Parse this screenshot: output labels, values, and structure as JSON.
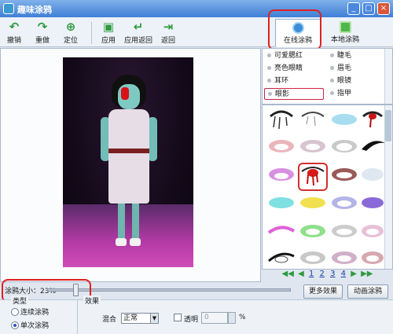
{
  "window": {
    "title": "趣味涂鸦",
    "controls": [
      "_",
      "□",
      "×"
    ]
  },
  "toolbar": {
    "undo": "撤销",
    "redo": "重做",
    "locate": "定位",
    "apply": "应用",
    "apply_back": "应用返回",
    "back": "返回"
  },
  "tabs": {
    "online": "在线涂鸦",
    "local": "本地涂鸦"
  },
  "categories": [
    "可爱腮红",
    "睫毛",
    "亮色眼睛",
    "眉毛",
    "耳环",
    "眼镜",
    "眼影",
    "指甲"
  ],
  "selected_category": "眼影",
  "pager": {
    "first": "◀◀",
    "prev": "◀",
    "pages": [
      "1",
      "2",
      "3",
      "4"
    ],
    "next": "▶",
    "last": "▶▶"
  },
  "brush": {
    "label": "涂鸦大小：23%",
    "percent": 23
  },
  "buttons": {
    "more_effects": "更多效果",
    "animated_doodle": "动画涂鸦"
  },
  "bottom": {
    "type_legend": "类型",
    "effect_legend": "效果",
    "continuous": "连续涂鸦",
    "single": "单次涂鸦",
    "mix_label": "混合",
    "mix_value": "正常",
    "transparent_label": "透明",
    "transparent_value": "0",
    "percent_sign": "%"
  },
  "colors": {
    "accent": "#3f7fd6",
    "annotation": "#e02020"
  }
}
